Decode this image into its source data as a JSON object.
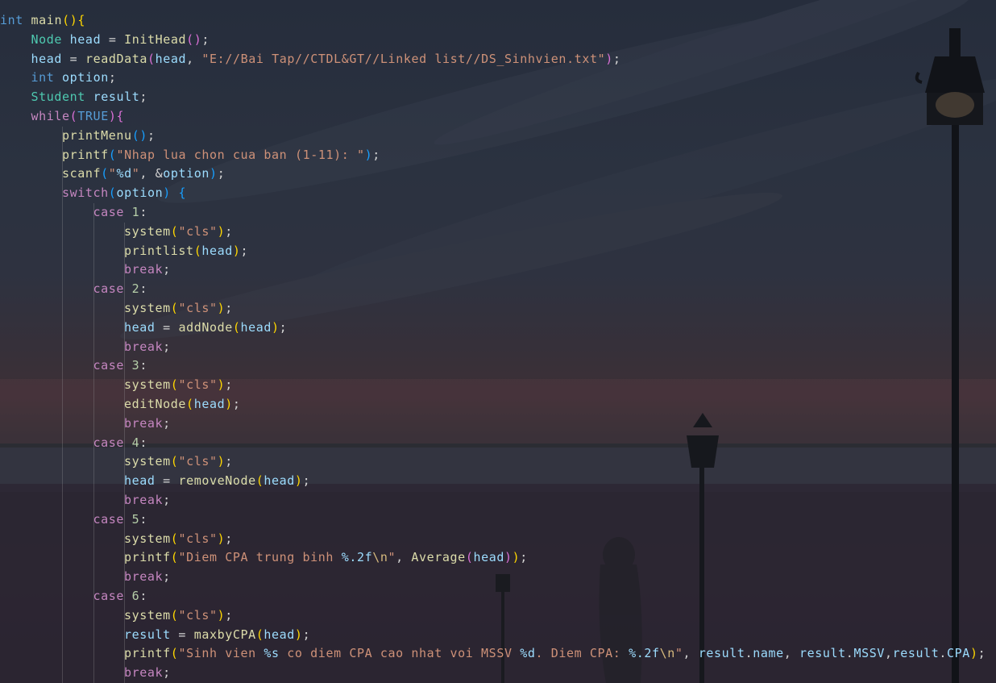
{
  "editor": {
    "language": "c",
    "lines": [
      [
        [
          "kw",
          "int"
        ],
        [
          "pl",
          " "
        ],
        [
          "fn",
          "main"
        ],
        [
          "b1",
          "()"
        ],
        [
          "b1",
          "{"
        ]
      ],
      [
        [
          "ty",
          "Node"
        ],
        [
          "pl",
          " "
        ],
        [
          "var",
          "head"
        ],
        [
          "pl",
          " = "
        ],
        [
          "fn",
          "InitHead"
        ],
        [
          "b2",
          "()"
        ],
        [
          "pl",
          ";"
        ]
      ],
      [
        [
          "var",
          "head"
        ],
        [
          "pl",
          " = "
        ],
        [
          "fn",
          "readData"
        ],
        [
          "b2",
          "("
        ],
        [
          "var",
          "head"
        ],
        [
          "pl",
          ", "
        ],
        [
          "str",
          "\"E://Bai Tap//CTDL&GT//Linked list//DS_Sinhvien.txt\""
        ],
        [
          "b2",
          ")"
        ],
        [
          "pl",
          ";"
        ]
      ],
      [
        [
          "kw",
          "int"
        ],
        [
          "pl",
          " "
        ],
        [
          "var",
          "option"
        ],
        [
          "pl",
          ";"
        ]
      ],
      [
        [
          "ty",
          "Student"
        ],
        [
          "pl",
          " "
        ],
        [
          "var",
          "result"
        ],
        [
          "pl",
          ";"
        ]
      ],
      [
        [
          "ctl",
          "while"
        ],
        [
          "b2",
          "("
        ],
        [
          "kw",
          "TRUE"
        ],
        [
          "b2",
          ")"
        ],
        [
          "b2",
          "{"
        ]
      ],
      [
        [
          "fn",
          "printMenu"
        ],
        [
          "b3",
          "()"
        ],
        [
          "pl",
          ";"
        ]
      ],
      [
        [
          "fn",
          "printf"
        ],
        [
          "b3",
          "("
        ],
        [
          "str",
          "\"Nhap lua chon cua ban (1-11): \""
        ],
        [
          "b3",
          ")"
        ],
        [
          "pl",
          ";"
        ]
      ],
      [
        [
          "fn",
          "scanf"
        ],
        [
          "b3",
          "("
        ],
        [
          "str",
          "\""
        ],
        [
          "var",
          "%d"
        ],
        [
          "str",
          "\""
        ],
        [
          "pl",
          ", &"
        ],
        [
          "var",
          "option"
        ],
        [
          "b3",
          ")"
        ],
        [
          "pl",
          ";"
        ]
      ],
      [
        [
          "ctl",
          "switch"
        ],
        [
          "b3",
          "("
        ],
        [
          "var",
          "option"
        ],
        [
          "b3",
          ")"
        ],
        [
          "pl",
          " "
        ],
        [
          "b3",
          "{"
        ]
      ],
      [
        [
          "ctl",
          "case"
        ],
        [
          "pl",
          " "
        ],
        [
          "num",
          "1"
        ],
        [
          "pl",
          ":"
        ]
      ],
      [
        [
          "fn",
          "system"
        ],
        [
          "b1",
          "("
        ],
        [
          "str",
          "\"cls\""
        ],
        [
          "b1",
          ")"
        ],
        [
          "pl",
          ";"
        ]
      ],
      [
        [
          "fn",
          "printlist"
        ],
        [
          "b1",
          "("
        ],
        [
          "var",
          "head"
        ],
        [
          "b1",
          ")"
        ],
        [
          "pl",
          ";"
        ]
      ],
      [
        [
          "ctl",
          "break"
        ],
        [
          "pl",
          ";"
        ]
      ],
      [
        [
          "ctl",
          "case"
        ],
        [
          "pl",
          " "
        ],
        [
          "num",
          "2"
        ],
        [
          "pl",
          ":"
        ]
      ],
      [
        [
          "fn",
          "system"
        ],
        [
          "b1",
          "("
        ],
        [
          "str",
          "\"cls\""
        ],
        [
          "b1",
          ")"
        ],
        [
          "pl",
          ";"
        ]
      ],
      [
        [
          "var",
          "head"
        ],
        [
          "pl",
          " = "
        ],
        [
          "fn",
          "addNode"
        ],
        [
          "b1",
          "("
        ],
        [
          "var",
          "head"
        ],
        [
          "b1",
          ")"
        ],
        [
          "pl",
          ";"
        ]
      ],
      [
        [
          "ctl",
          "break"
        ],
        [
          "pl",
          ";"
        ]
      ],
      [
        [
          "ctl",
          "case"
        ],
        [
          "pl",
          " "
        ],
        [
          "num",
          "3"
        ],
        [
          "pl",
          ":"
        ]
      ],
      [
        [
          "fn",
          "system"
        ],
        [
          "b1",
          "("
        ],
        [
          "str",
          "\"cls\""
        ],
        [
          "b1",
          ")"
        ],
        [
          "pl",
          ";"
        ]
      ],
      [
        [
          "fn",
          "editNode"
        ],
        [
          "b1",
          "("
        ],
        [
          "var",
          "head"
        ],
        [
          "b1",
          ")"
        ],
        [
          "pl",
          ";"
        ]
      ],
      [
        [
          "ctl",
          "break"
        ],
        [
          "pl",
          ";"
        ]
      ],
      [
        [
          "ctl",
          "case"
        ],
        [
          "pl",
          " "
        ],
        [
          "num",
          "4"
        ],
        [
          "pl",
          ":"
        ]
      ],
      [
        [
          "fn",
          "system"
        ],
        [
          "b1",
          "("
        ],
        [
          "str",
          "\"cls\""
        ],
        [
          "b1",
          ")"
        ],
        [
          "pl",
          ";"
        ]
      ],
      [
        [
          "var",
          "head"
        ],
        [
          "pl",
          " = "
        ],
        [
          "fn",
          "removeNode"
        ],
        [
          "b1",
          "("
        ],
        [
          "var",
          "head"
        ],
        [
          "b1",
          ")"
        ],
        [
          "pl",
          ";"
        ]
      ],
      [
        [
          "ctl",
          "break"
        ],
        [
          "pl",
          ";"
        ]
      ],
      [
        [
          "ctl",
          "case"
        ],
        [
          "pl",
          " "
        ],
        [
          "num",
          "5"
        ],
        [
          "pl",
          ":"
        ]
      ],
      [
        [
          "fn",
          "system"
        ],
        [
          "b1",
          "("
        ],
        [
          "str",
          "\"cls\""
        ],
        [
          "b1",
          ")"
        ],
        [
          "pl",
          ";"
        ]
      ],
      [
        [
          "fn",
          "printf"
        ],
        [
          "b1",
          "("
        ],
        [
          "str",
          "\"Diem CPA trung binh "
        ],
        [
          "var",
          "%.2f"
        ],
        [
          "esc",
          "\\n"
        ],
        [
          "str",
          "\""
        ],
        [
          "pl",
          ", "
        ],
        [
          "fn",
          "Average"
        ],
        [
          "b2",
          "("
        ],
        [
          "var",
          "head"
        ],
        [
          "b2",
          ")"
        ],
        [
          "b1",
          ")"
        ],
        [
          "pl",
          ";"
        ]
      ],
      [
        [
          "ctl",
          "break"
        ],
        [
          "pl",
          ";"
        ]
      ],
      [
        [
          "ctl",
          "case"
        ],
        [
          "pl",
          " "
        ],
        [
          "num",
          "6"
        ],
        [
          "pl",
          ":"
        ]
      ],
      [
        [
          "fn",
          "system"
        ],
        [
          "b1",
          "("
        ],
        [
          "str",
          "\"cls\""
        ],
        [
          "b1",
          ")"
        ],
        [
          "pl",
          ";"
        ]
      ],
      [
        [
          "var",
          "result"
        ],
        [
          "pl",
          " = "
        ],
        [
          "fn",
          "maxbyCPA"
        ],
        [
          "b1",
          "("
        ],
        [
          "var",
          "head"
        ],
        [
          "b1",
          ")"
        ],
        [
          "pl",
          ";"
        ]
      ],
      [
        [
          "fn",
          "printf"
        ],
        [
          "b1",
          "("
        ],
        [
          "str",
          "\"Sinh vien "
        ],
        [
          "var",
          "%s"
        ],
        [
          "str",
          " co diem CPA cao nhat voi MSSV "
        ],
        [
          "var",
          "%d"
        ],
        [
          "str",
          ". Diem CPA: "
        ],
        [
          "var",
          "%.2f"
        ],
        [
          "esc",
          "\\n"
        ],
        [
          "str",
          "\""
        ],
        [
          "pl",
          ", "
        ],
        [
          "var",
          "result"
        ],
        [
          "pl",
          "."
        ],
        [
          "var",
          "name"
        ],
        [
          "pl",
          ", "
        ],
        [
          "var",
          "result"
        ],
        [
          "pl",
          "."
        ],
        [
          "var",
          "MSSV"
        ],
        [
          "pl",
          ","
        ],
        [
          "var",
          "result"
        ],
        [
          "pl",
          "."
        ],
        [
          "var",
          "CPA"
        ],
        [
          "b1",
          ")"
        ],
        [
          "pl",
          ";"
        ]
      ],
      [
        [
          "ctl",
          "break"
        ],
        [
          "pl",
          ";"
        ]
      ]
    ]
  },
  "background": {
    "theme": "night-sky-street-lamp-wallpaper"
  }
}
